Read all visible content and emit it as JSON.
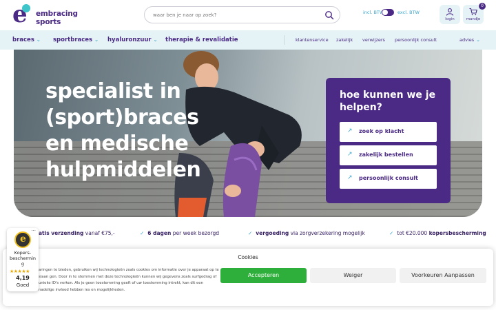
{
  "brand": {
    "name": "embracing sports"
  },
  "search": {
    "placeholder": "waar ben je naar op zoek?"
  },
  "vat": {
    "incl_label": "incl. BTW",
    "excl_label": "excl. BTW"
  },
  "header_buttons": {
    "login_label": "login",
    "cart_label": "mandje",
    "cart_count": "0"
  },
  "nav": {
    "main": [
      {
        "label": "braces",
        "has_dropdown": true
      },
      {
        "label": "sportbraces",
        "has_dropdown": true
      },
      {
        "label": "hyaluronzuur",
        "has_dropdown": true
      },
      {
        "label": "therapie & revalidatie",
        "has_dropdown": false
      }
    ],
    "secondary": [
      "klantenservice",
      "zakelijk",
      "verwijzers",
      "persoonlijk consult"
    ],
    "advies": {
      "label": "advies",
      "has_dropdown": true
    }
  },
  "hero": {
    "title_lines": [
      "specialist in",
      "(sport)braces",
      "en medische",
      "hulpmiddelen"
    ],
    "help": {
      "title": "hoe kunnen we je helpen?",
      "buttons": [
        "zoek op klacht",
        "zakelijk bestellen",
        "persoonlijk consult"
      ]
    }
  },
  "usps": [
    {
      "bold": "atis verzending",
      "text": " vanaf €75,-",
      "bold_first": true
    },
    {
      "bold": "6 dagen",
      "text": " per week bezorgd",
      "bold_first": true
    },
    {
      "bold": "vergoeding",
      "text": " via zorgverzekering mogelijk",
      "bold_first": true
    },
    {
      "bold": "kopersbescherming",
      "text": "tot €20.000 ",
      "bold_first": false
    }
  ],
  "trust_badge": {
    "label": "Kopers-beschermin g",
    "score": "4,19",
    "rating_text": "Goed",
    "stars": "★★★★★",
    "menu": "..."
  },
  "cookie": {
    "title": "Cookies",
    "text": "aringen te bieden, gebruiken wij technologieën zoals cookies om informatie over je apparaat op te slaan gen. Door in te stemmen met deze technologieën kunnen wij gegevens zoals surfgedrag of unieke ID's verken. Als je geen toestemming geeft of uw toestemming intrekt, kan dit een nadelige invloed hebben ies en mogelijkheden.",
    "accept_label": "Accepteren",
    "deny_label": "Weiger",
    "prefs_label": "Voorkeuren Aanpassen"
  },
  "colors": {
    "brand_purple": "#4b2a85",
    "accent_teal": "#3ba4c9",
    "nav_bg": "#e5f3f6",
    "accept_green": "#2eae3a"
  }
}
